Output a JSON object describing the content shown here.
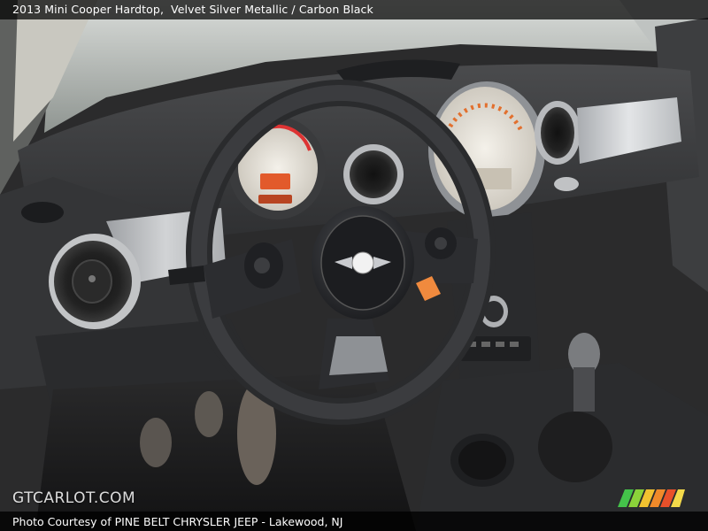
{
  "caption": {
    "vehicle": "2013 Mini Cooper Hardtop,",
    "color": "Velvet Silver Metallic / Carbon Black"
  },
  "watermark": "GTCARLOT.COM",
  "footer": {
    "credit": "Photo Courtesy of PINE BELT CHRYSLER JEEP - Lakewood, NJ"
  },
  "badge": "MINI"
}
